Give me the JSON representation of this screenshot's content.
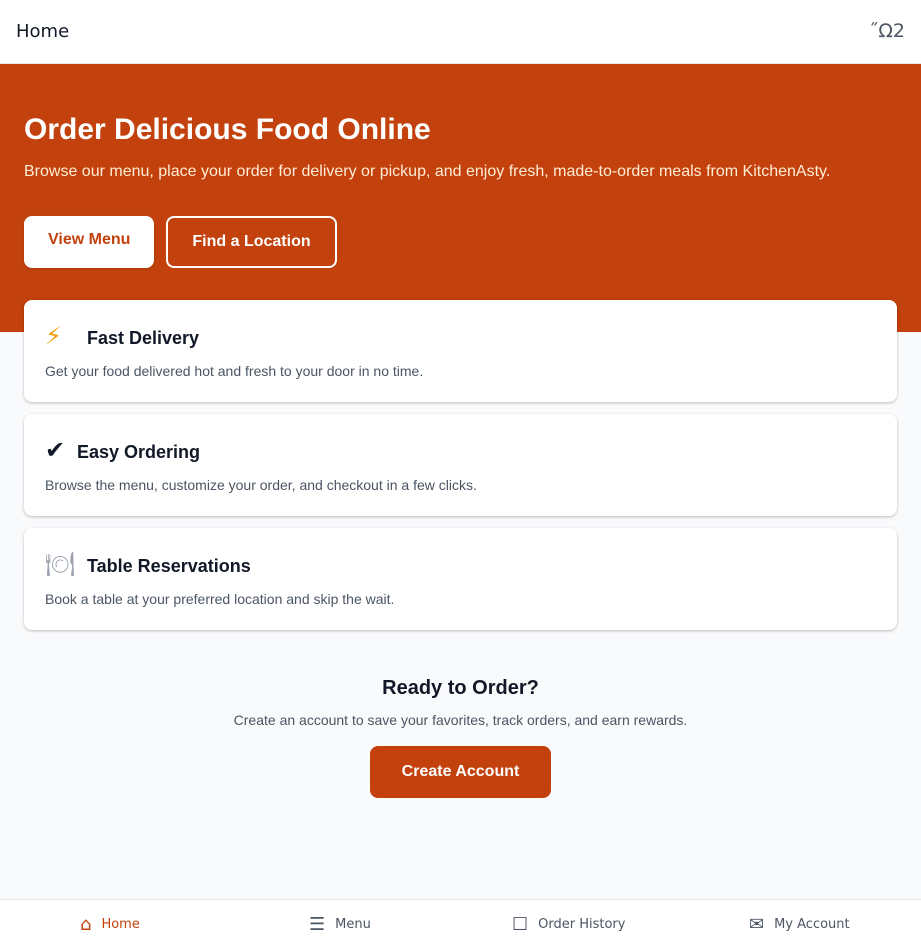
{
  "topbar": {
    "title": "Home",
    "icon_glyph": "˝Ω2",
    "icon_name": "account-glyph"
  },
  "hero": {
    "title": "Order Delicious Food Online",
    "subtitle": "Browse our menu, place your order for delivery or pickup, and enjoy fresh, made-to-order meals from KitchenAsty.",
    "primary_button": "View Menu",
    "secondary_button": "Find a Location",
    "background_color": "#c2410c"
  },
  "features": [
    {
      "icon": "⚡",
      "icon_name": "lightning-icon",
      "title": "Fast Delivery",
      "description": "Get your food delivered hot and fresh to your door in no time."
    },
    {
      "icon": "✔",
      "icon_name": "checkmark-icon",
      "title": "Easy Ordering",
      "description": "Browse the menu, customize your order, and checkout in a few clicks."
    },
    {
      "icon": "🍽",
      "icon_name": "plate-icon",
      "title": "Table Reservations",
      "description": "Book a table at your preferred location and skip the wait."
    }
  ],
  "cta": {
    "title": "Ready to Order?",
    "description": "Create an account to save your favorites, track orders, and earn rewards.",
    "button": "Create Account"
  },
  "bottom_nav": [
    {
      "icon": "⌂",
      "icon_name": "home-icon",
      "label": "Home",
      "active": true
    },
    {
      "icon": "☰",
      "icon_name": "menu-icon",
      "label": "Menu",
      "active": false
    },
    {
      "icon": "☐",
      "icon_name": "order-history-icon",
      "label": "Order History",
      "active": false
    },
    {
      "icon": "✉",
      "icon_name": "envelope-icon",
      "label": "My Account",
      "active": false
    }
  ],
  "colors": {
    "accent": "#c2410c",
    "hero_text_muted": "#ffedd5",
    "lightning": "#f59e0b"
  }
}
